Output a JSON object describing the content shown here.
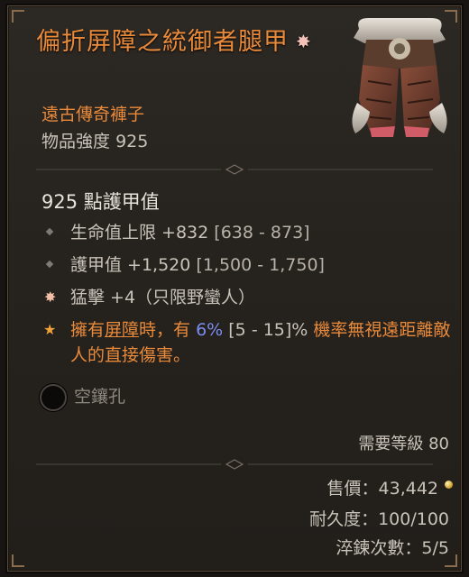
{
  "item": {
    "name": "偏折屏障之統御者腿甲",
    "rarity": "遠古傳奇褲子",
    "power_label": "物品強度",
    "power_value": "925",
    "armor_line": "925 點護甲值",
    "affixes": [
      {
        "text": "生命值上限 +832",
        "range": "[638 - 873]"
      },
      {
        "text": "護甲值 +1,520",
        "range": "[1,500 - 1,750]"
      }
    ],
    "unique_affix": "猛擊 +4（只限野蠻人）",
    "legendary": {
      "part1": "擁有",
      "keyword": "屏障",
      "part2": "時，有 ",
      "value": "6%",
      "range": " [5 - 15]%",
      "part3": " 機率無視遠距離敵人的直接傷害。"
    },
    "socket_label": "空鑲孔",
    "required_level": "需要等級 80",
    "sell_value": "售價：43,442",
    "durability": "耐久度：100/100",
    "temper": "淬鍊次數：5/5"
  },
  "icons": {
    "unique_marker": "unique-item-icon",
    "gold": "gold-coin-icon",
    "socket": "empty-socket-icon"
  },
  "colors": {
    "legendary": "#e98a3b",
    "text": "#c9c3b9",
    "highlight": "#7b8cf0"
  }
}
